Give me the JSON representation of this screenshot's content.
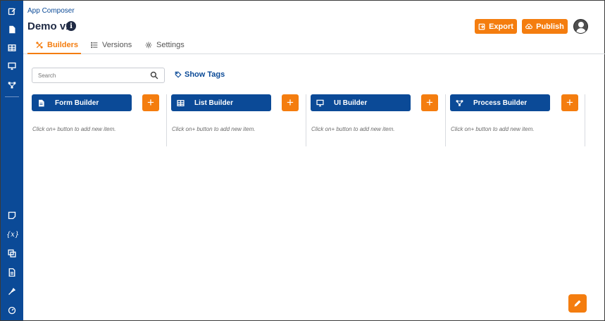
{
  "app": {
    "name": "App Composer",
    "title": "Demo v1"
  },
  "header": {
    "export_label": "Export",
    "publish_label": "Publish"
  },
  "tabs": [
    {
      "label": "Builders",
      "active": true,
      "icon": "builders-icon"
    },
    {
      "label": "Versions",
      "active": false,
      "icon": "list-icon"
    },
    {
      "label": "Settings",
      "active": false,
      "icon": "gear-icon"
    }
  ],
  "search": {
    "placeholder": "Search"
  },
  "show_tags_label": "Show Tags",
  "columns": [
    {
      "title": "Form Builder",
      "icon": "form-icon",
      "hint": "Click on+ button to add new item."
    },
    {
      "title": "List Builder",
      "icon": "table-icon",
      "hint": "Click on+ button to add new item."
    },
    {
      "title": "UI Builder",
      "icon": "monitor-icon",
      "hint": "Click on+ button to add new item."
    },
    {
      "title": "Process Builder",
      "icon": "process-icon",
      "hint": "Click on+ button to add new item."
    }
  ],
  "add_label": "+",
  "sidebar": {
    "variables_label": "{x}",
    "icons": [
      "edit-icon",
      "form-icon",
      "table-icon",
      "monitor-icon",
      "process-icon",
      "note-icon",
      "variables-icon",
      "layers-icon",
      "document-icon",
      "plugin-icon",
      "dashboard-icon"
    ]
  },
  "colors": {
    "primary": "#0b4a97",
    "accent": "#f47d0f"
  }
}
